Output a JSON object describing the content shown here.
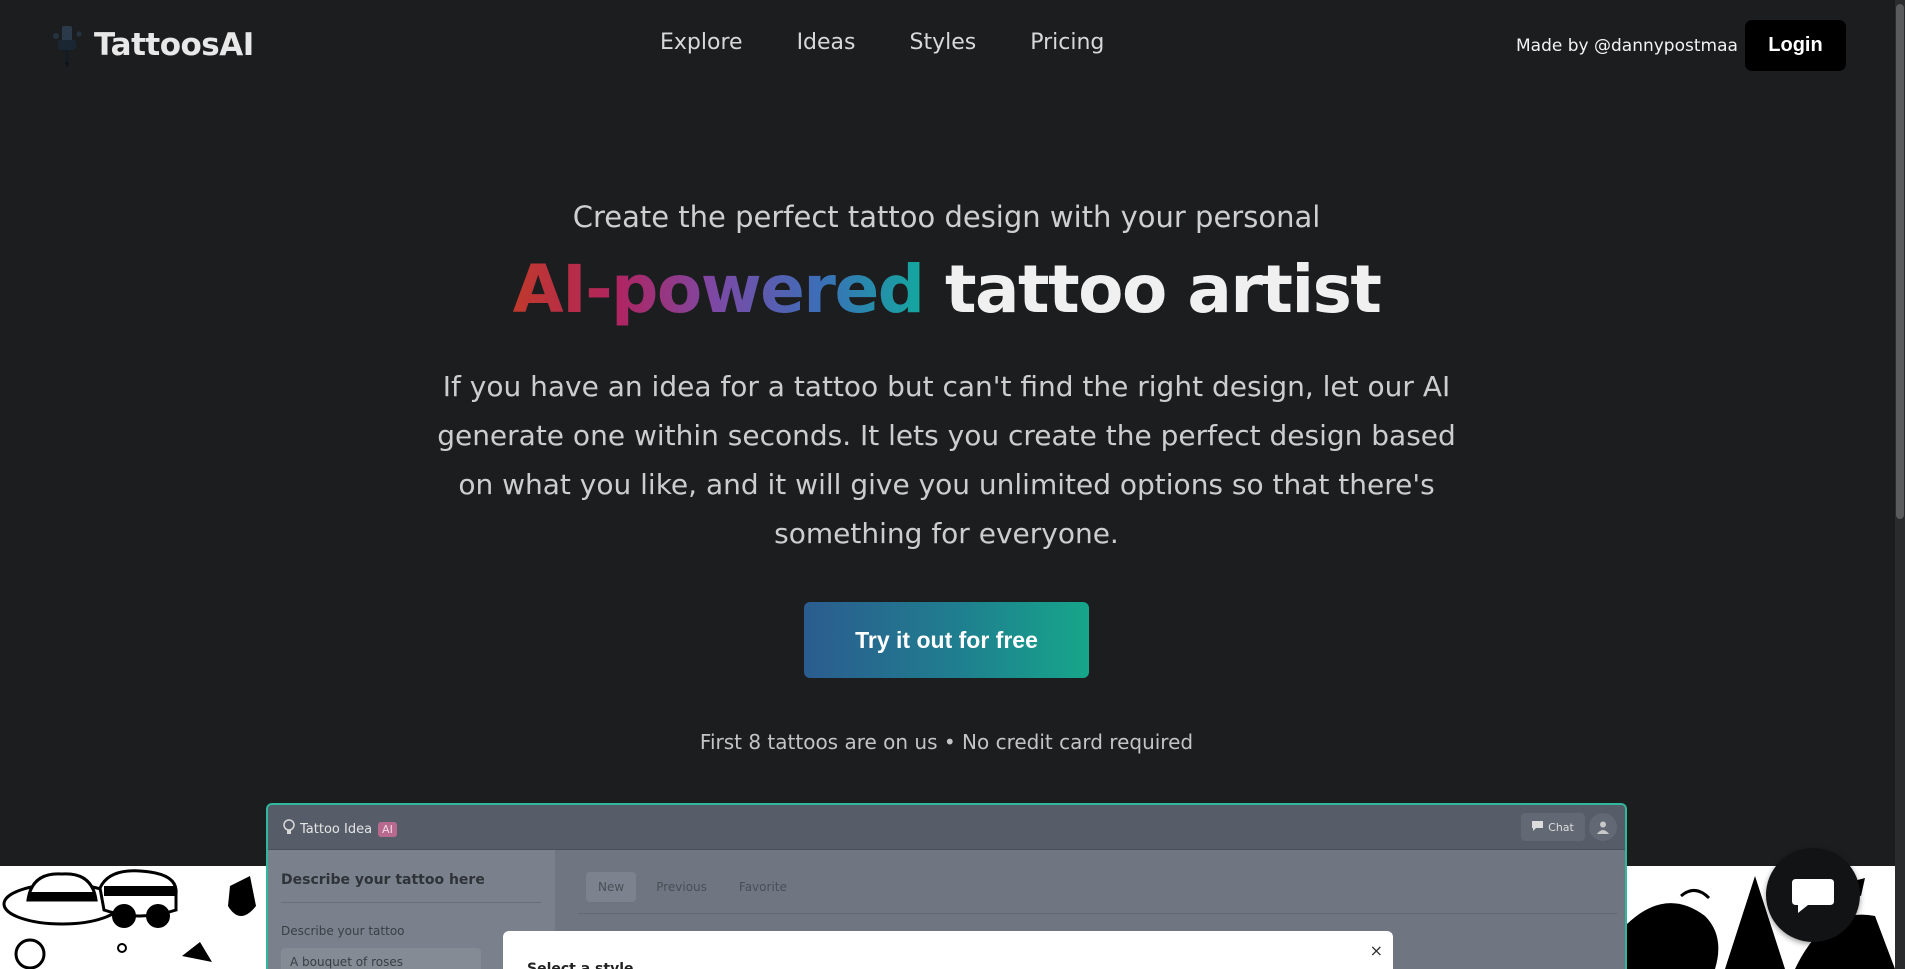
{
  "header": {
    "brand": "TattoosAI",
    "nav": [
      "Explore",
      "Ideas",
      "Styles",
      "Pricing"
    ],
    "made_by": "Made by @dannypostmaa",
    "login": "Login"
  },
  "hero": {
    "subtitle": "Create the perfect tattoo design with your personal",
    "title_gradient": "AI-powered",
    "title_rest": "tattoo artist",
    "description": "If you have an idea for a tattoo but can't find the right design, let our AI generate one within seconds. It lets you create the perfect design based on what you like, and it will give you unlimited options so that there's something for everyone.",
    "cta": "Try it out for free",
    "note": "First 8 tattoos are on us • No credit card required"
  },
  "preview": {
    "brand": "Tattoo Idea",
    "ai_badge": "AI",
    "chat": "Chat",
    "left_title": "Describe your tattoo here",
    "left_label": "Describe your tattoo",
    "left_input_placeholder": "A bouquet of roses",
    "tabs": [
      "New",
      "Previous",
      "Favorite"
    ],
    "modal_title": "Select a style",
    "modal_close": "×"
  },
  "colors": {
    "background": "#1c1d1f",
    "cta_start": "#2b5c8f",
    "cta_end": "#16a68a",
    "preview_border": "#2fb89d"
  },
  "icons": {
    "brand": "tattoo-machine-icon",
    "chat_fab": "chat-bubble-icon",
    "user": "user-icon"
  }
}
